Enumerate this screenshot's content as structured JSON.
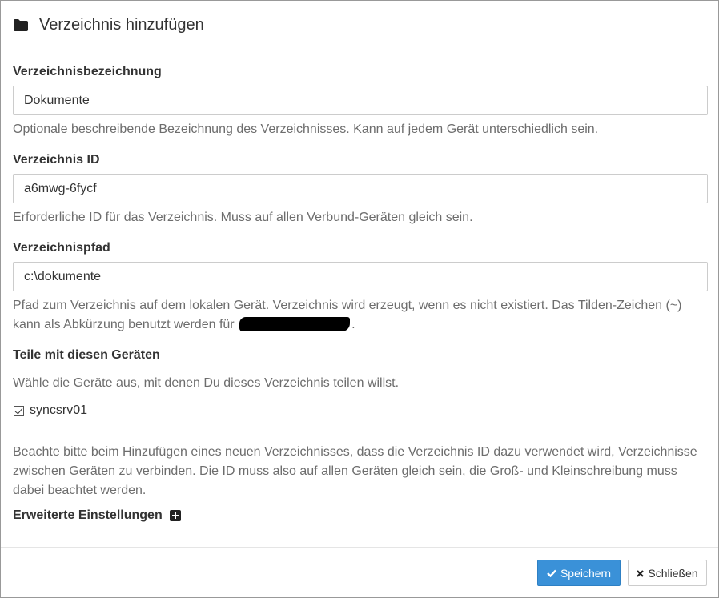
{
  "dialog": {
    "title": "Verzeichnis hinzufügen",
    "title_icon": "folder-icon"
  },
  "fields": {
    "label_field": {
      "label": "Verzeichnisbezeichnung",
      "value": "Dokumente",
      "help": "Optionale beschreibende Bezeichnung des Verzeichnisses. Kann auf jedem Gerät unterschiedlich sein."
    },
    "id_field": {
      "label": "Verzeichnis ID",
      "value": "a6mwg-6fycf",
      "help": "Erforderliche ID für das Verzeichnis. Muss auf allen Verbund-Geräten gleich sein."
    },
    "path_field": {
      "label": "Verzeichnispfad",
      "value": "c:\\dokumente",
      "help_prefix": "Pfad zum Verzeichnis auf dem lokalen Gerät. Verzeichnis wird erzeugt, wenn es nicht existiert. Das Tilden-Zeichen (~) kann als Abkürzung benutzt werden für",
      "help_suffix": "."
    }
  },
  "share": {
    "heading": "Teile mit diesen Geräten",
    "help": "Wähle die Geräte aus, mit denen Du dieses Verzeichnis teilen willst.",
    "devices": [
      {
        "name": "syncsrv01",
        "checked": true
      }
    ]
  },
  "note": "Beachte bitte beim Hinzufügen eines neuen Verzeichnisses, dass die Verzeichnis ID dazu verwendet wird, Verzeichnisse zwischen Geräten zu verbinden. Die ID muss also auf allen Geräten gleich sein, die Groß- und Kleinschreibung muss dabei beachtet werden.",
  "advanced": {
    "label": "Erweiterte Einstellungen",
    "icon": "plus-square-icon"
  },
  "footer": {
    "save_label": "Speichern",
    "save_icon": "check-icon",
    "close_label": "Schließen",
    "close_icon": "x-icon"
  },
  "colors": {
    "primary": "#3a91d8",
    "help_text": "#6d6d6d"
  }
}
